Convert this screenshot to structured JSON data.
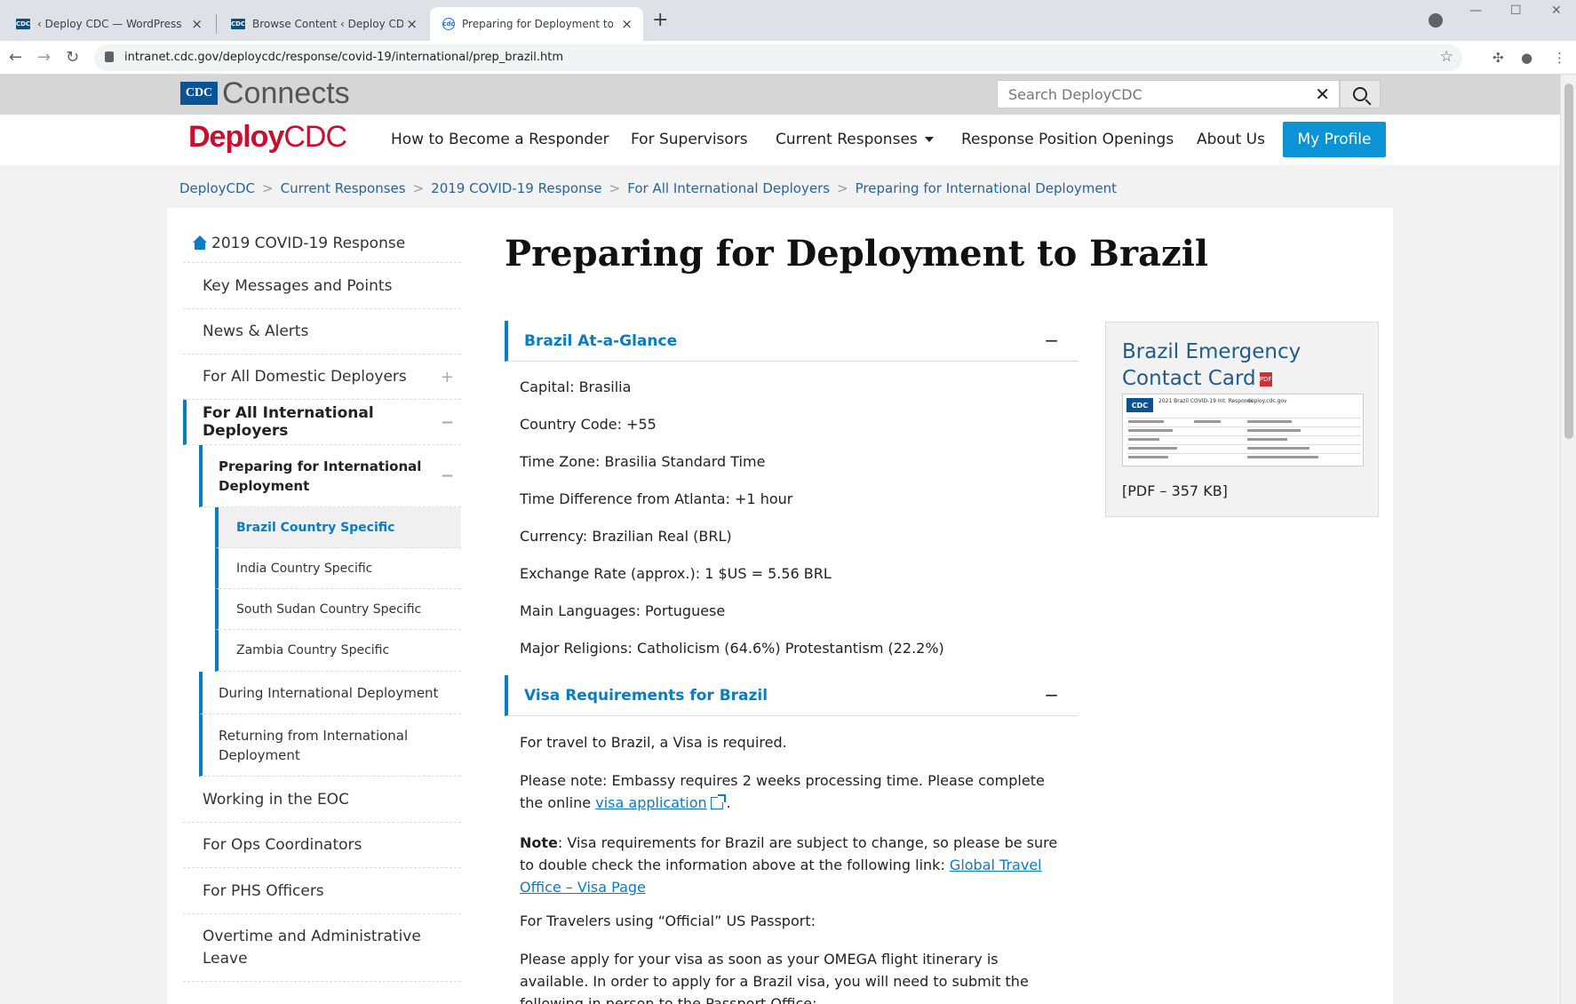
{
  "browser": {
    "tabs": [
      {
        "title": "‹ Deploy CDC — WordPress",
        "favicon": "CDC"
      },
      {
        "title": "Browse Content ‹ Deploy CDC —",
        "favicon": "CDC"
      },
      {
        "title": "Preparing for Deployment to Bra",
        "favicon": "cdc"
      }
    ],
    "url": "intranet.cdc.gov/deploycdc/response/covid-19/international/prep_brazil.htm"
  },
  "header": {
    "logo_badge": "CDC",
    "logo_text": "Connects",
    "search_placeholder": "Search DeployCDC"
  },
  "nav": {
    "brand_bold": "Deploy",
    "brand_light": "CDC",
    "links": [
      "How to Become a Responder",
      "For Supervisors",
      "Current Responses",
      "Response Position Openings",
      "About Us"
    ],
    "profile_label": "My Profile"
  },
  "breadcrumb": [
    "DeployCDC",
    "Current Responses",
    "2019 COVID-19 Response",
    "For All International Deployers",
    "Preparing for International Deployment"
  ],
  "sidebar": {
    "home": "2019 COVID-19 Response",
    "items": [
      "Key Messages and Points",
      "News & Alerts",
      "For All Domestic Deployers",
      "For All International Deployers",
      "Preparing for International Deployment",
      "Brazil Country Specific",
      "India Country Specific",
      "South Sudan Country Specific",
      "Zambia Country Specific",
      "During International Deployment",
      "Returning from International Deployment",
      "Working in the EOC",
      "For Ops Coordinators",
      "For PHS Officers",
      "Overtime and Administrative Leave"
    ]
  },
  "main": {
    "title": "Preparing for Deployment to Brazil",
    "glance_heading": "Brazil At-a-Glance",
    "glance": [
      "Capital: Brasilia",
      "Country Code: +55",
      "Time Zone: Brasilia Standard Time",
      "Time Difference from Atlanta: +1 hour",
      "Currency: Brazilian Real (BRL)",
      "Exchange Rate (approx.): 1 $US = 5.56 BRL",
      "Main Languages: Portuguese",
      "Major Religions: Catholicism (64.6%) Protestantism (22.2%)"
    ],
    "visa_heading": "Visa Requirements for Brazil",
    "visa_required": "For travel to Brazil, a Visa is required.",
    "visa_note_pre": "Please note: Embassy requires 2 weeks processing time. Please complete the online",
    "visa_link": "visa application",
    "visa_note_post": ".",
    "note_label": "Note",
    "note_text": ": Visa requirements for Brazil are subject to change, so please be sure to double check the information above at the following link:",
    "note_link": "Global Travel Office – Visa Page",
    "official": "For Travelers using “Official” US Passport:",
    "apply": "Please apply for your visa as soon as your OMEGA flight itinerary is available. In order to apply for a Brazil visa, you will need to submit the following in person to the Passport Office:"
  },
  "sidecard": {
    "title": "Brazil Emergency Contact Card",
    "pdf_label": "PDF",
    "thumb_header": "2021 Brazil COVID-19 Int. Response",
    "thumb_header2": "deploy.cdc.gov",
    "thumb_badge": "CDC",
    "meta": "[PDF – 357 KB]"
  }
}
